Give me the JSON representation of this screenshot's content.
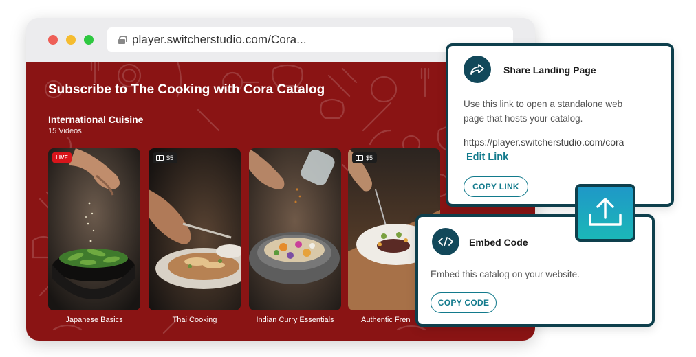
{
  "browser": {
    "url": "player.switcherstudio.com/Cora..."
  },
  "catalog": {
    "title": "Subscribe to The Cooking with Cora Catalog",
    "section_title": "International Cuisine",
    "section_count": "15 Videos",
    "videos": [
      {
        "label": "Japanese Basics",
        "badge": "LIVE"
      },
      {
        "label": "Thai Cooking",
        "badge": "$5"
      },
      {
        "label": "Indian Curry Essentials",
        "badge": ""
      },
      {
        "label": "Authentic Fren",
        "badge": "$5"
      }
    ]
  },
  "share_panel": {
    "icon": "share-arrow-icon",
    "title": "Share Landing Page",
    "description_line1": "Use this link to open a standalone web",
    "description_line2": "page that hosts your catalog.",
    "url": "https://player.switcherstudio.com/cora",
    "edit_link": "Edit Link",
    "copy_button": "COPY LINK"
  },
  "embed_panel": {
    "icon": "code-icon",
    "title": "Embed Code",
    "description": "Embed this catalog on your website.",
    "copy_button": "COPY CODE"
  },
  "upload_button": {
    "icon": "upload-icon"
  },
  "colors": {
    "catalog_bg": "#8a1414",
    "panel_border": "#0e3f4c",
    "accent": "#127a8c",
    "live_badge": "#d8151b"
  }
}
